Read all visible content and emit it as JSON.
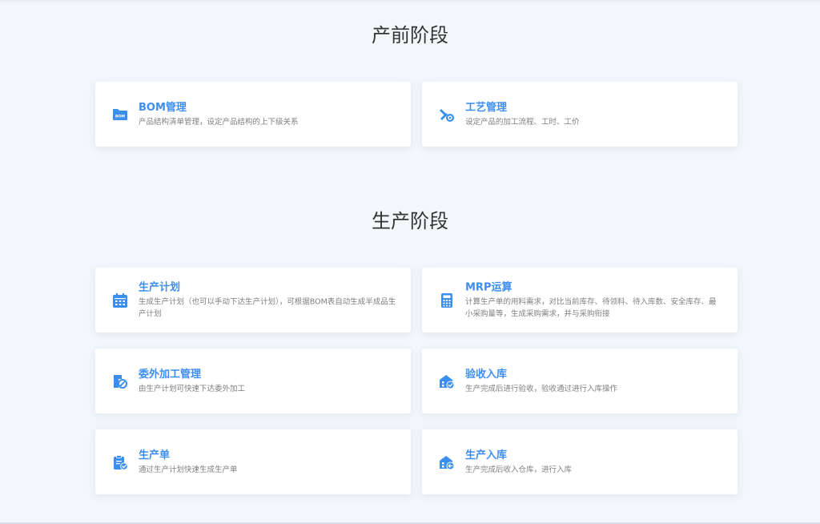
{
  "sections": [
    {
      "title": "产前阶段"
    },
    {
      "title": "生产阶段"
    }
  ],
  "cards": [
    {
      "title": "BOM管理",
      "desc": "产品结构清单管理，设定产品结构的上下级关系",
      "icon": "bom-folder-icon"
    },
    {
      "title": "工艺管理",
      "desc": "设定产品的加工流程、工时、工价",
      "icon": "process-tools-icon"
    },
    {
      "title": "生产计划",
      "desc": "生成生产计划（也可以手动下达生产计划），可根据BOM表自动生成半成品生产计划",
      "icon": "calendar-icon"
    },
    {
      "title": "MRP运算",
      "desc": "计算生产单的用料需求，对比当前库存、待领料、待入库数、安全库存、最小采购量等，生成采购需求，并与采购衔接",
      "icon": "calculator-icon"
    },
    {
      "title": "委外加工管理",
      "desc": "由生产计划可快速下达委外加工",
      "icon": "outsource-icon"
    },
    {
      "title": "验收入库",
      "desc": "生产完成后进行验收，验收通过进行入库操作",
      "icon": "warehouse-check-icon"
    },
    {
      "title": "生产单",
      "desc": "通过生产计划快速生成生产单",
      "icon": "clipboard-check-icon"
    },
    {
      "title": "生产入库",
      "desc": "生产完成后收入仓库，进行入库",
      "icon": "warehouse-in-icon"
    }
  ],
  "colors": {
    "accent": "#3d8ef0",
    "icon": "#3a8ef0",
    "background": "#f3f7fc",
    "card": "#ffffff"
  },
  "bom_icon_label": "BOM"
}
